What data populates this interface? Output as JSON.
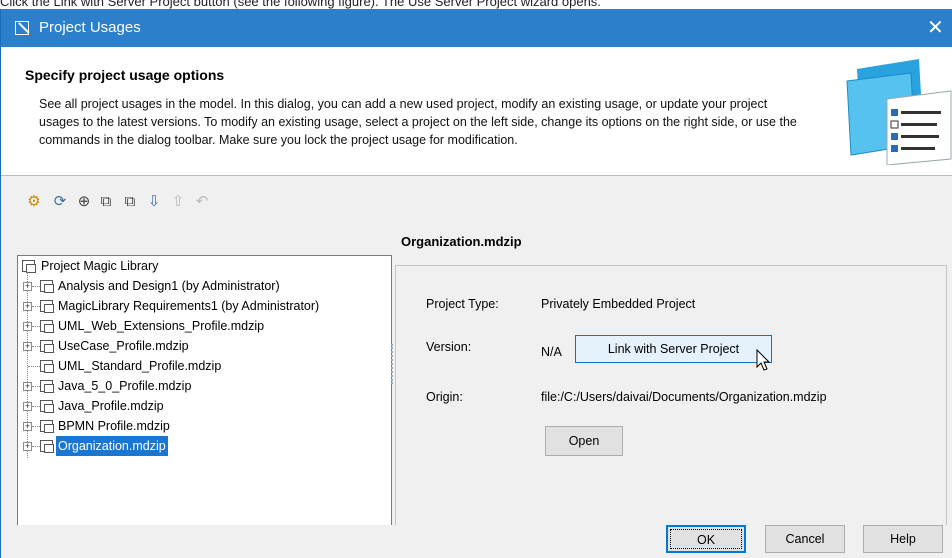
{
  "caption": "Click the Link with Server Project button (see the following figure). The Use Server Project wizard opens.",
  "window": {
    "title": "Project Usages",
    "close_glyph": "✕"
  },
  "header": {
    "title": "Specify project usage options",
    "description": "See all project usages in the model. In this dialog, you can add a new used project, modify an existing usage, or update your project usages to the latest versions. To modify an existing usage, select a project on the left side, change its options on the right side, or use the commands in the dialog toolbar. Make sure you lock the project usage for modification."
  },
  "toolbar": {
    "icons": [
      "gear-icon",
      "refresh-icon",
      "lock-icon",
      "copy-icon",
      "paste-icon",
      "import-icon",
      "export-icon",
      "undo-icon"
    ]
  },
  "tree": {
    "root": "Project Magic Library",
    "items": [
      {
        "label": "Analysis and Design1 (by Administrator)",
        "expandable": true
      },
      {
        "label": "MagicLibrary Requirements1 (by Administrator)",
        "expandable": true
      },
      {
        "label": "UML_Web_Extensions_Profile.mdzip",
        "expandable": true
      },
      {
        "label": "UseCase_Profile.mdzip",
        "expandable": true
      },
      {
        "label": "UML_Standard_Profile.mdzip",
        "expandable": false
      },
      {
        "label": "Java_5_0_Profile.mdzip",
        "expandable": true
      },
      {
        "label": "Java_Profile.mdzip",
        "expandable": true
      },
      {
        "label": "BPMN Profile.mdzip",
        "expandable": true
      },
      {
        "label": "Organization.mdzip",
        "expandable": true,
        "selected": true
      }
    ]
  },
  "details": {
    "title": "Organization.mdzip",
    "project_type_label": "Project Type:",
    "project_type_value": "Privately Embedded Project",
    "version_label": "Version:",
    "version_value": "N/A",
    "link_button": "Link with Server Project",
    "origin_label": "Origin:",
    "origin_value": "file:/C:/Users/daivai/Documents/Organization.mdzip",
    "open_button": "Open"
  },
  "footer": {
    "ok": "OK",
    "cancel": "Cancel",
    "help": "Help"
  },
  "colors": {
    "titlebar": "#2b7fcb",
    "selection": "#1976d2",
    "focus_border": "#0078d7"
  }
}
